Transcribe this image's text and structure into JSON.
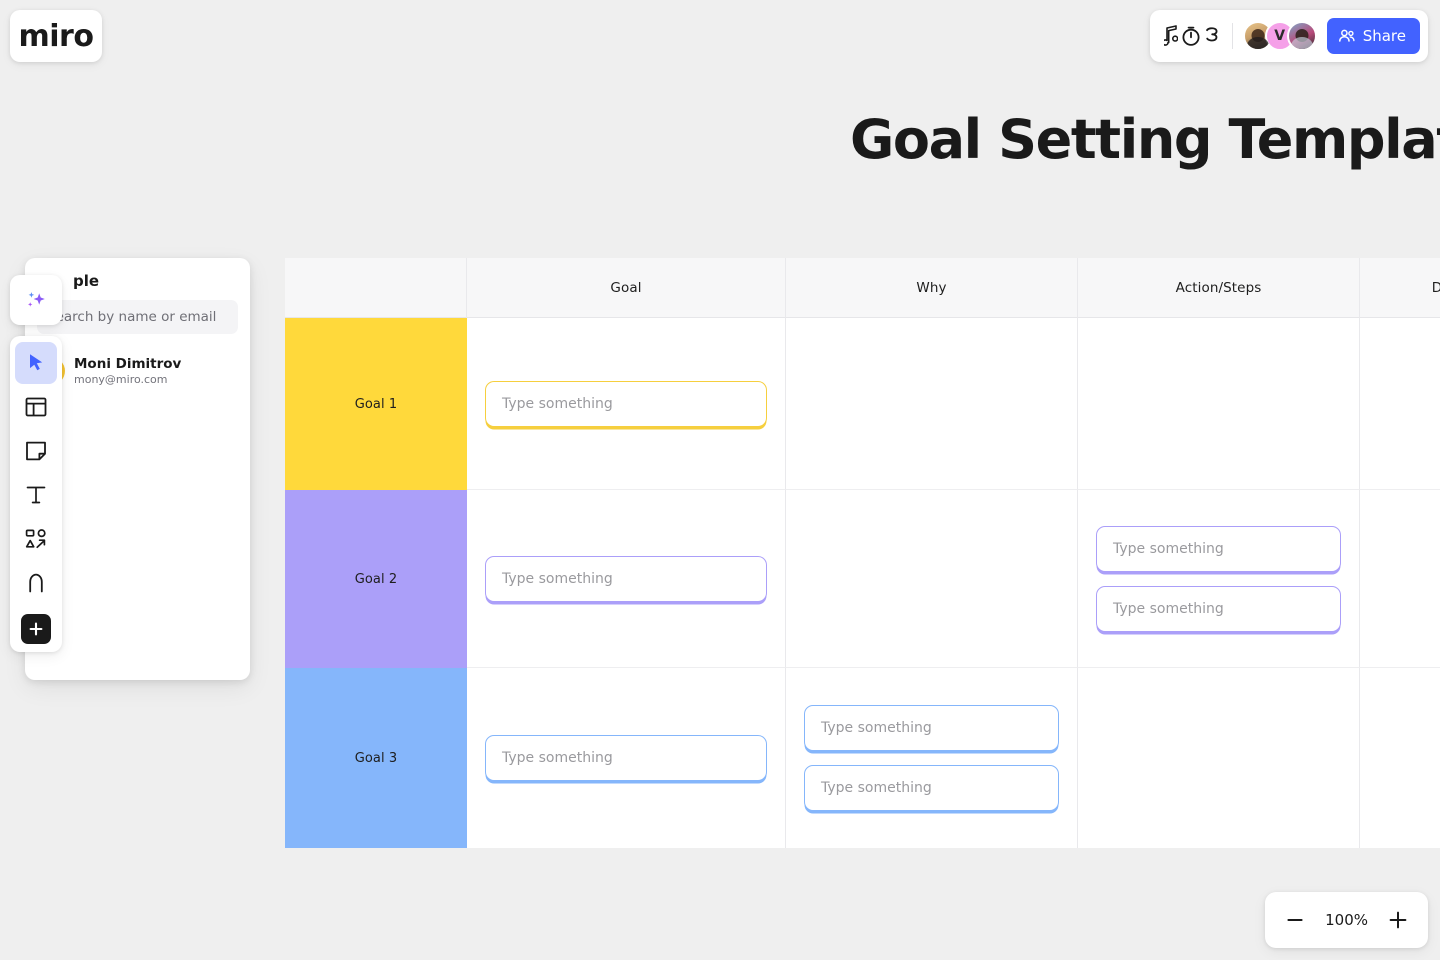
{
  "app": {
    "logo_text": "miro",
    "board_title": "Goal Setting Template"
  },
  "topbar": {
    "icons": [
      "music-note-icon",
      "timer-icon",
      "comment-icon"
    ],
    "share_label": "Share",
    "avatars": [
      {
        "name": "avatar-photo-1",
        "initial": ""
      },
      {
        "name": "avatar-initial-v",
        "initial": "V"
      },
      {
        "name": "avatar-photo-2",
        "initial": ""
      }
    ]
  },
  "people_panel": {
    "title": "People",
    "title_visible": "ple",
    "search_placeholder": "Search by name or email",
    "search_value": "",
    "members": [
      {
        "name": "Moni Dimitrov",
        "email": "mony@miro.com"
      }
    ]
  },
  "toolbar": {
    "ai_tool": "ai-sparkle",
    "items": [
      {
        "name": "select-tool",
        "icon": "cursor-icon",
        "active": true
      },
      {
        "name": "template-tool",
        "icon": "frame-icon",
        "active": false
      },
      {
        "name": "sticky-note-tool",
        "icon": "sticky-note-icon",
        "active": false
      },
      {
        "name": "text-tool",
        "icon": "text-t-icon",
        "active": false
      },
      {
        "name": "shapes-tool",
        "icon": "shapes-icon",
        "active": false
      },
      {
        "name": "pen-tool",
        "icon": "pen-icon",
        "active": false
      },
      {
        "name": "more-apps-tool",
        "icon": "plus-icon",
        "active": false
      }
    ]
  },
  "table": {
    "headers": [
      "",
      "Goal",
      "Why",
      "Action/Steps",
      "D"
    ],
    "placeholder": "Type something",
    "rows": [
      {
        "label": "Goal 1",
        "color": "#ffd93b",
        "color_class": "c-yellow",
        "tone": "t-yellow",
        "goal_inputs": 1,
        "why_inputs": 0,
        "action_inputs": 0,
        "deadline_inputs": 0
      },
      {
        "label": "Goal 2",
        "color": "#ab9ff9",
        "color_class": "c-purple",
        "tone": "t-purple",
        "goal_inputs": 1,
        "why_inputs": 0,
        "action_inputs": 2,
        "deadline_inputs": 0
      },
      {
        "label": "Goal 3",
        "color": "#85b6fb",
        "color_class": "c-blue",
        "tone": "t-blue",
        "goal_inputs": 1,
        "why_inputs": 2,
        "action_inputs": 0,
        "deadline_inputs": 0
      }
    ]
  },
  "zoom": {
    "value": "100%",
    "minus_label": "−",
    "plus_label": "+"
  },
  "colors": {
    "canvas": "#efefef",
    "accent_blue": "#4262ff",
    "goal1": "#ffd93b",
    "goal2": "#ab9ff9",
    "goal3": "#85b6fb",
    "header_bg": "#f7f7f8"
  }
}
